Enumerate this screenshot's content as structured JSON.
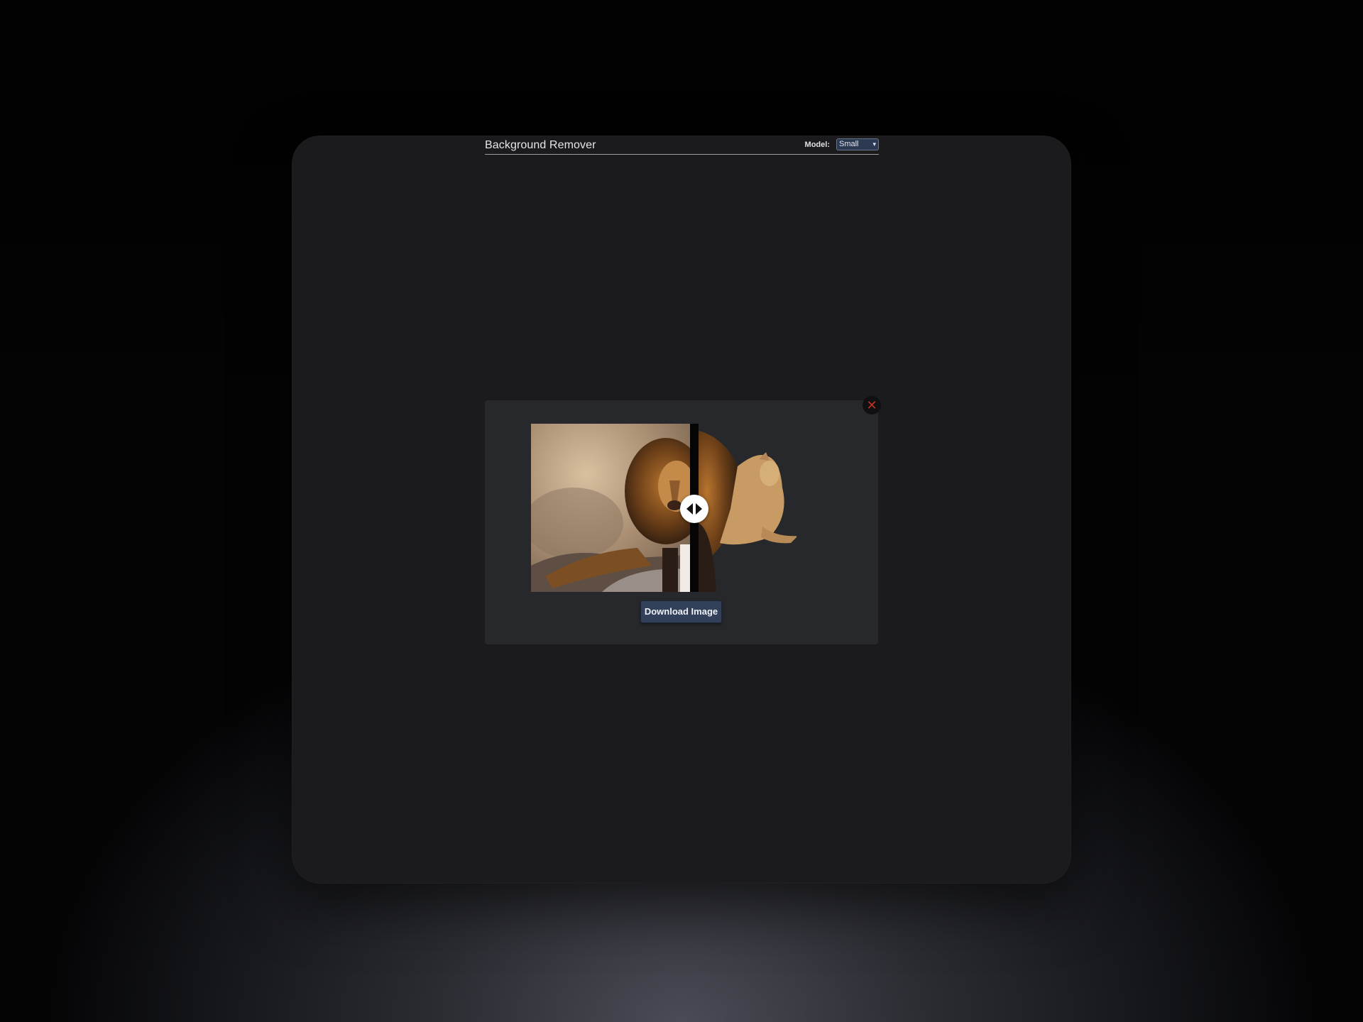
{
  "app": {
    "title": "Background Remover"
  },
  "model": {
    "label": "Model:",
    "selected": "Small",
    "chevron": "▾"
  },
  "result_panel": {
    "close_icon": "✕",
    "download_label": "Download Image"
  },
  "icons": {
    "close": "close-icon",
    "slider_handle": "left-right-arrows-icon"
  },
  "colors": {
    "window_bg": "#1b1b1d",
    "panel_bg": "#27282c",
    "accent_button": "#33405a",
    "close_icon": "#c23222"
  }
}
